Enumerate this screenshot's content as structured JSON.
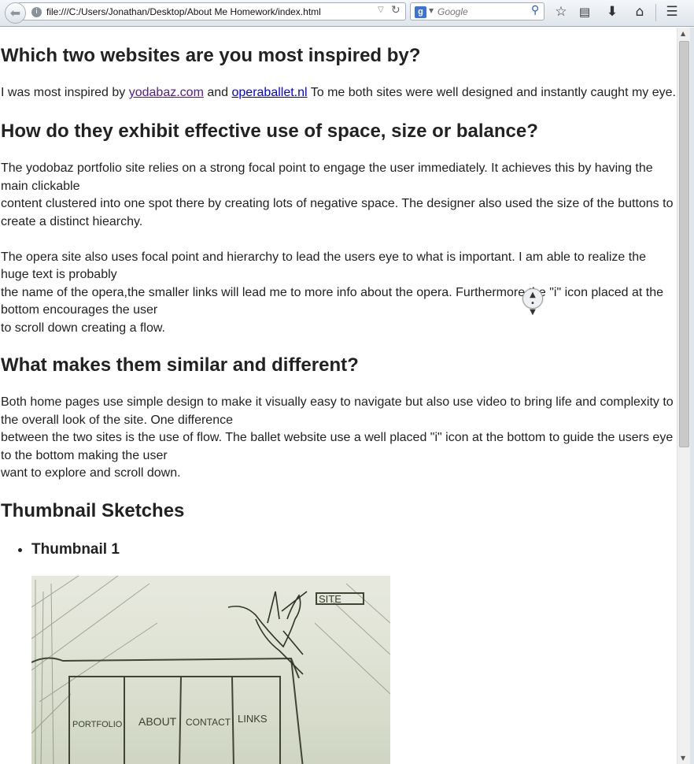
{
  "browser": {
    "url": "file:///C:/Users/Jonathan/Desktop/About Me Homework/index.html",
    "search_placeholder": "Google",
    "icons": {
      "back": "back-arrow-icon",
      "site_identity": "globe-icon",
      "url_dropdown": "chevron-down-icon",
      "reload": "reload-icon",
      "search_engine": "google-icon",
      "search": "magnifier-icon",
      "bookmark": "star-icon",
      "bookmarks_menu": "clipboard-icon",
      "downloads": "download-arrow-icon",
      "home": "home-icon",
      "menu": "hamburger-menu-icon"
    }
  },
  "page": {
    "q1_heading": "Which two websites are you most inspired by?",
    "p1": {
      "prefix": "I was most inspired by ",
      "link1": "yodabaz.com",
      "middle": " and ",
      "link2": "operaballet.nl",
      "suffix": " To me both sites were well designed and instantly caught my eye."
    },
    "q2_heading": "How do they exhibit effective use of space, size or balance?",
    "p2_lines": [
      "The yodobaz portfolio site relies on a strong focal point to engage the user immediately. It achieves this by having the main clickable",
      "content clustered into one spot there by creating lots of negative space. The designer also used the size of the buttons to create a distinct hiearchy.",
      "",
      "The opera site also uses focal point and hierarchy to lead the users eye to what is important. I am able to realize the huge text is probably",
      "the name of the opera,the smaller links will lead me to more info about the opera. Furthermore the \"i\" icon placed at the bottom encourages the user",
      "to scroll down creating a flow."
    ],
    "q3_heading": "What makes them similar and different?",
    "p3_lines": [
      "Both home pages use simple design to make it visually easy to navigate but also use video to bring life and complexity to the overall look of the site. One difference",
      "between the two sites is the use of flow. The ballet website use a well placed \"i\" icon at the bottom to guide the users eye to the bottom making the user",
      "want to explore and scroll down."
    ],
    "q4_heading": "Thumbnail Sketches",
    "thumbnails": [
      "Thumbnail 1"
    ],
    "sketch_labels": [
      "SITE",
      "PORTFOLIO",
      "ABOUT",
      "CONTACT",
      "LINKS"
    ]
  },
  "colors": {
    "link_visited": "#551a8b",
    "link": "#0000ee",
    "text": "#222222",
    "toolbar_top": "#f4f6f9",
    "toolbar_bottom": "#dfe5ec"
  }
}
